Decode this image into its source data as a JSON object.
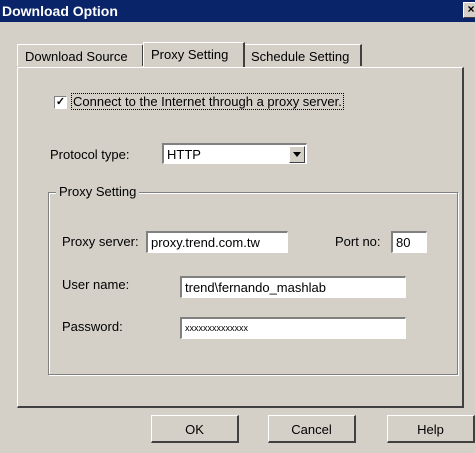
{
  "window": {
    "title": "Download Option",
    "close_glyph": "×"
  },
  "tabs": [
    {
      "label": "Download Source",
      "active": false
    },
    {
      "label": "Proxy Setting",
      "active": true
    },
    {
      "label": "Schedule Setting",
      "active": false
    }
  ],
  "proxy_enable": {
    "checked": true,
    "check_glyph": "✓",
    "label": "Connect to the Internet through a proxy server."
  },
  "protocol": {
    "label": "Protocol type:",
    "selected": "HTTP"
  },
  "proxy_group": {
    "title": "Proxy Setting",
    "server_label": "Proxy server:",
    "server_value": "proxy.trend.com.tw",
    "port_label": "Port no:",
    "port_value": "80",
    "username_label": "User name:",
    "username_value": "trend\\fernando_mashlab",
    "password_label": "Password:",
    "password_value": "xxxxxxxxxxxxxx"
  },
  "buttons": {
    "ok": "OK",
    "cancel": "Cancel",
    "help": "Help"
  },
  "colors": {
    "titlebar": "#0a246a",
    "face": "#d4d0c8"
  }
}
